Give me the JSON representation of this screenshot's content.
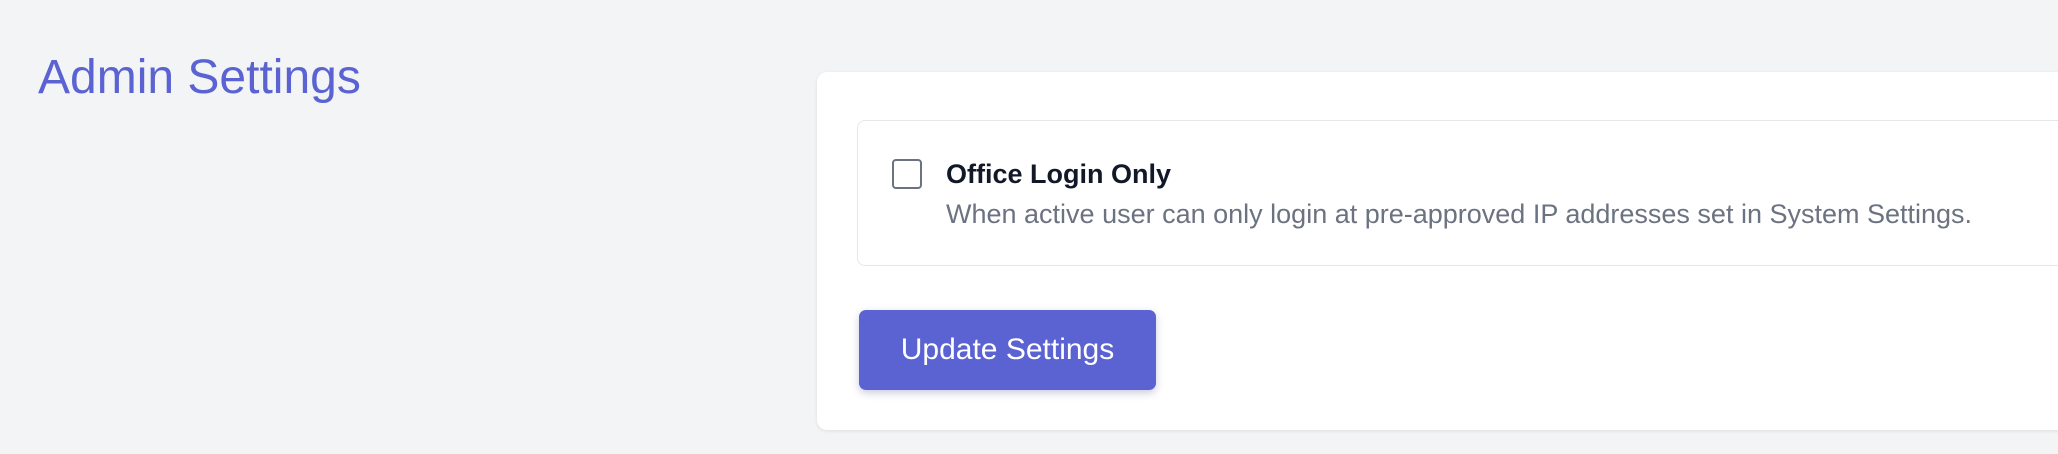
{
  "page": {
    "title": "Admin Settings"
  },
  "settings": {
    "option": {
      "label": "Office Login Only",
      "description": "When active user can only login at pre-approved IP addresses set in System Settings.",
      "checked": false
    },
    "update_button_label": "Update Settings"
  },
  "colors": {
    "accent": "#5a63d1",
    "background": "#f3f4f6",
    "card": "#ffffff",
    "text_primary": "#111827",
    "text_secondary": "#6b7280"
  },
  "icons": {
    "checkbox": "unchecked-checkbox-icon"
  }
}
